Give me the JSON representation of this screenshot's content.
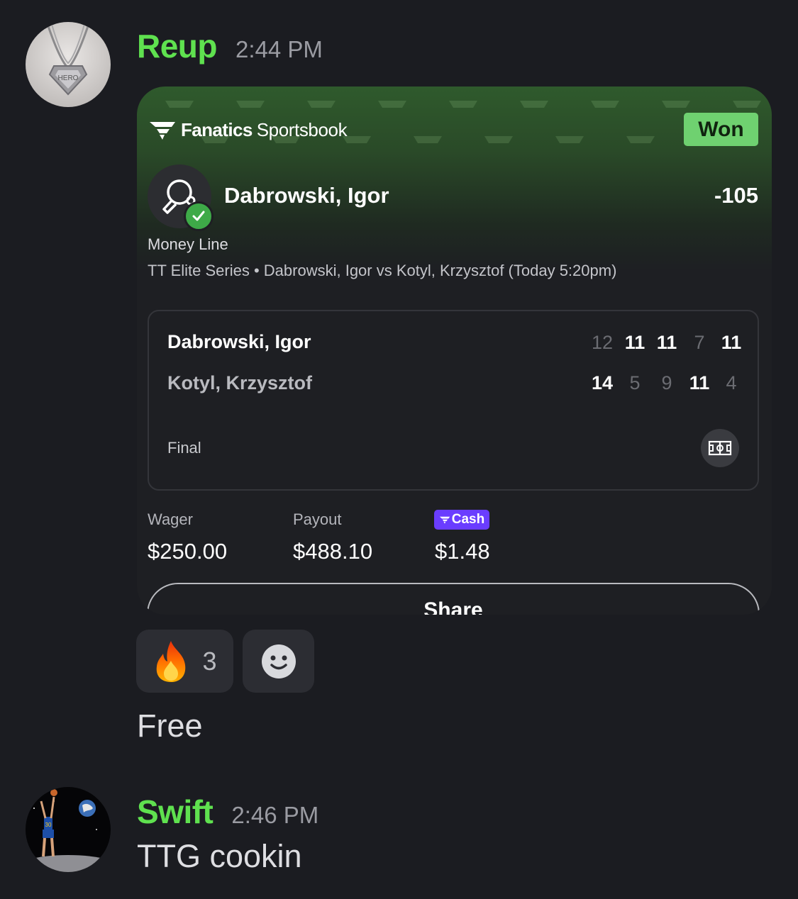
{
  "messages": [
    {
      "username": "Reup",
      "time": "2:44 PM",
      "text": "Free",
      "reactions": [
        {
          "emoji": "🔥",
          "count": "3"
        },
        {
          "emoji": "add-reaction",
          "count": ""
        }
      ]
    },
    {
      "username": "Swift",
      "time": "2:46 PM",
      "text": "TTG cookin"
    }
  ],
  "bet": {
    "brand_bold": "Fanatics",
    "brand_light": "Sportsbook",
    "status": "Won",
    "selection": "Dabrowski, Igor",
    "odds": "-105",
    "market": "Money Line",
    "event": "TT Elite Series • Dabrowski, Igor vs Kotyl, Krzysztof (Today 5:20pm)",
    "players": [
      {
        "name": "Dabrowski, Igor",
        "scores": [
          "12",
          "11",
          "11",
          "7",
          "11"
        ]
      },
      {
        "name": "Kotyl, Krzysztof",
        "scores": [
          "14",
          "5",
          "9",
          "11",
          "4"
        ]
      }
    ],
    "game_status": "Final",
    "wager_label": "Wager",
    "wager": "$250.00",
    "payout_label": "Payout",
    "payout": "$488.10",
    "cash_label": "Cash",
    "cash": "$1.48",
    "share_label": "Share"
  },
  "colors": {
    "background": "#1b1c21",
    "username": "#5fe14f",
    "won_badge": "#6fd170",
    "cash_badge": "#6a3dff"
  }
}
